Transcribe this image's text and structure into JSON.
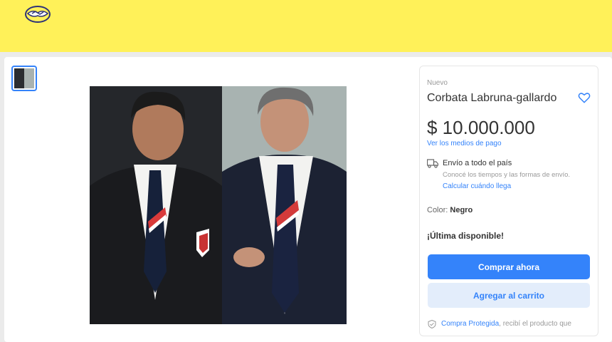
{
  "product": {
    "condition": "Nuevo",
    "title": "Corbata Labruna-gallardo",
    "price": "$ 10.000.000",
    "payment_link": "Ver los medios de pago",
    "shipping": {
      "title": "Envío a todo el país",
      "subtitle": "Conocé los tiempos y las formas de envío.",
      "link": "Calcular cuándo llega"
    },
    "color_label": "Color:",
    "color_value": "Negro",
    "stock": "¡Última disponible!",
    "buy_button": "Comprar ahora",
    "cart_button": "Agregar al carrito",
    "protect_link": "Compra Protegida",
    "protect_text": ", recibí el producto que"
  },
  "colors": {
    "header_yellow": "#fff159",
    "accent_blue": "#3483fa"
  },
  "icons": [
    "mercadolibre-logo",
    "heart-icon",
    "truck-icon",
    "shield-icon"
  ]
}
